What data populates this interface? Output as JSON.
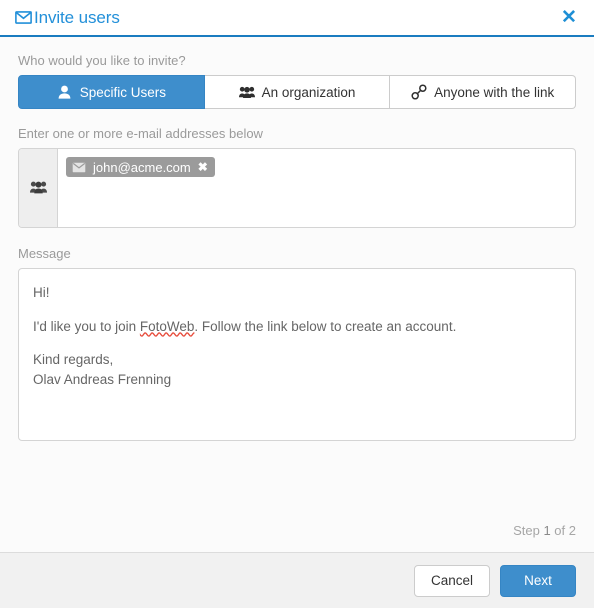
{
  "dialog": {
    "title": "Invite users",
    "title_icon": "envelope-icon",
    "close_icon": "✕",
    "accent_color": "#2390d9",
    "primary_button_color": "#3e8ecc"
  },
  "audience": {
    "label": "Who would you like to invite?",
    "tabs": [
      {
        "label": "Specific Users",
        "icon": "user-icon",
        "active": true
      },
      {
        "label": "An organization",
        "icon": "users-group-icon",
        "active": false
      },
      {
        "label": "Anyone with the link",
        "icon": "link-icon",
        "active": false
      }
    ]
  },
  "recipients": {
    "label": "Enter one or more e-mail addresses below",
    "addon_icon": "users-group-icon",
    "tokens": [
      {
        "email": "john@acme.com",
        "icon": "envelope-icon",
        "remove_icon": "✖"
      }
    ]
  },
  "message": {
    "label": "Message",
    "lines": {
      "greeting": "Hi!",
      "body_prefix": "I'd like you to join ",
      "body_highlight": "FotoWeb",
      "body_suffix": ". Follow the link below to create an account.",
      "closing": "Kind regards,",
      "signature": "Olav Andreas Frenning"
    }
  },
  "progress": {
    "prefix": "Step",
    "current": "1",
    "separator": "of",
    "total": "2"
  },
  "footer": {
    "cancel_label": "Cancel",
    "next_label": "Next"
  }
}
